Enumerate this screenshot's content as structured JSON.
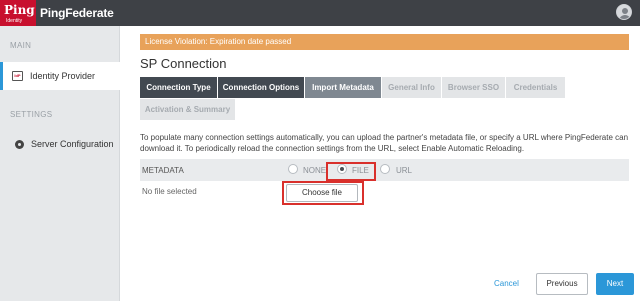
{
  "header": {
    "logo_text": "Ping",
    "logo_sub": "Identity",
    "product_name": "PingFederate",
    "user_icon": "user-icon"
  },
  "sidebar": {
    "main_header": "MAIN",
    "identity_provider": "Identity Provider",
    "settings_header": "SETTINGS",
    "server_configuration": "Server Configuration"
  },
  "banner": {
    "text": "License Violation: Expiration date passed",
    "color": "#e8a25a"
  },
  "page_title": "SP Connection",
  "tabs": [
    {
      "label": "Connection Type",
      "state": "done"
    },
    {
      "label": "Connection Options",
      "state": "done"
    },
    {
      "label": "Import Metadata",
      "state": "current"
    },
    {
      "label": "General Info",
      "state": "future"
    },
    {
      "label": "Browser SSO",
      "state": "future"
    },
    {
      "label": "Credentials",
      "state": "future"
    },
    {
      "label": "Activation & Summary",
      "state": "future"
    }
  ],
  "description": "To populate many connection settings automatically, you can upload the partner's metadata file, or specify a URL where PingFederate can download it. To periodically reload the connection settings from the URL, select Enable Automatic Reloading.",
  "metadata": {
    "label": "METADATA",
    "options": [
      "NONE",
      "FILE",
      "URL"
    ],
    "selected": "FILE"
  },
  "file": {
    "status": "No file selected",
    "choose_label": "Choose file"
  },
  "footer": {
    "cancel": "Cancel",
    "previous": "Previous",
    "next": "Next"
  },
  "colors": {
    "accent": "#2b97d8",
    "topbar": "#3e4146",
    "brand": "#c8102e",
    "highlight": "#d9302c"
  }
}
